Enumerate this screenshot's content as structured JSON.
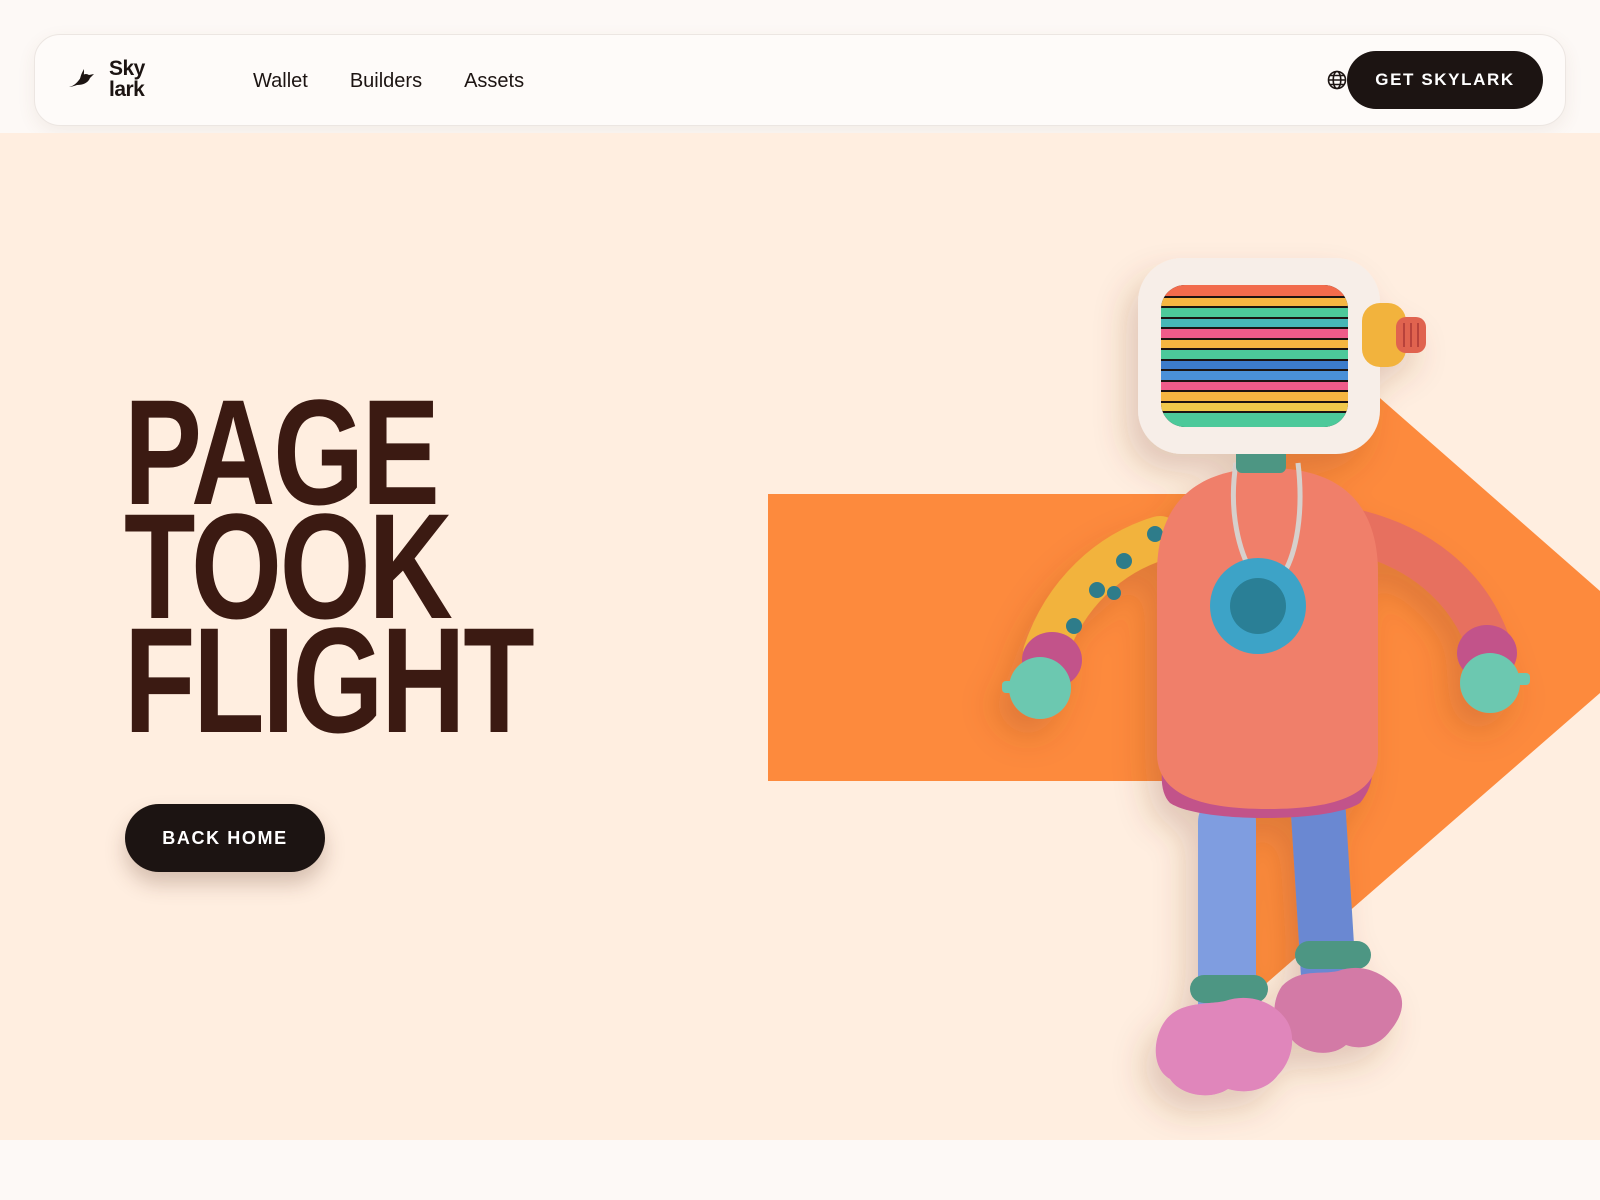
{
  "nav": {
    "logo": {
      "line1": "Sky",
      "line2": "lark",
      "icon": "bird-logo-icon"
    },
    "links": [
      {
        "label": "Wallet"
      },
      {
        "label": "Builders"
      },
      {
        "label": "Assets"
      }
    ],
    "language_icon": "globe-icon",
    "cta_label": "GET SKYLARK"
  },
  "hero": {
    "headline": [
      "PAGE",
      "TOOK",
      "FLIGHT"
    ],
    "back_button_label": "BACK HOME",
    "illustration": "robot-tv-head-character"
  },
  "colors": {
    "background": "#ffeee0",
    "headline": "#3b1a12",
    "button": "#1c1412",
    "arrow": "#fd8a3d"
  }
}
